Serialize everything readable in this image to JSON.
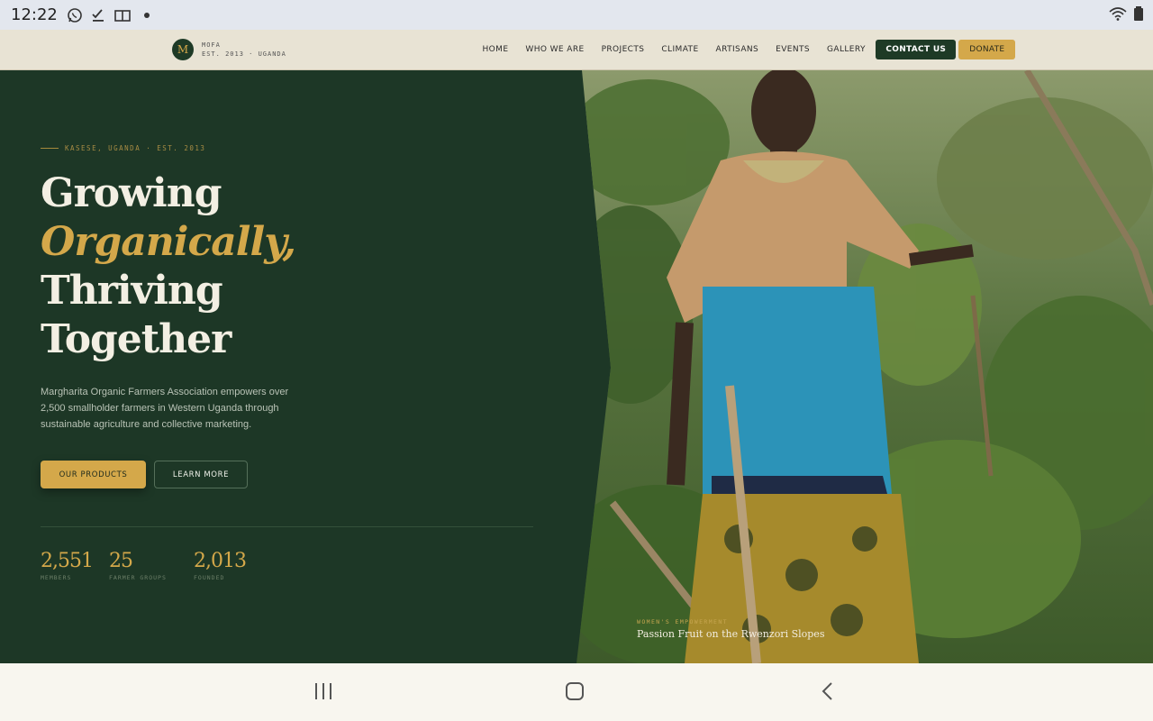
{
  "status_bar": {
    "time": "12:22"
  },
  "header": {
    "logo_letter": "M",
    "logo_name": "MOFA",
    "logo_tagline": "EST. 2013 · UGANDA",
    "nav": [
      "HOME",
      "WHO WE ARE",
      "PROJECTS",
      "CLIMATE",
      "ARTISANS",
      "EVENTS",
      "GALLERY"
    ],
    "contact_label": "CONTACT US",
    "donate_label": "DONATE"
  },
  "hero": {
    "eyebrow": "KASESE, UGANDA · EST. 2013",
    "headline_1": "Growing",
    "headline_2": "Organically,",
    "headline_3": "Thriving",
    "headline_4": "Together",
    "lede": "Margharita Organic Farmers Association empowers over 2,500 smallholder farmers in Western Uganda through sustainable agriculture and collective marketing.",
    "btn_products": "OUR PRODUCTS",
    "btn_learn": "LEARN MORE",
    "stats": [
      {
        "num": "2,551",
        "label": "MEMBERS"
      },
      {
        "num": "25",
        "label": "FARMER GROUPS"
      },
      {
        "num": "2,013",
        "label": "FOUNDED"
      }
    ],
    "caption_kicker": "WOMEN'S EMPOWERMENT",
    "caption_title": "Passion Fruit on the Rwenzori Slopes"
  },
  "colors": {
    "forest": "#1d3726",
    "gold": "#d4a84a",
    "cream": "#f3efe3"
  }
}
